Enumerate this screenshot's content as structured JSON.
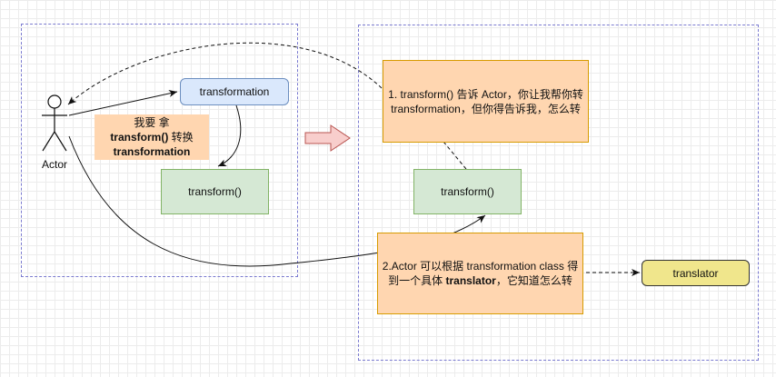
{
  "actor": {
    "label": "Actor"
  },
  "nodes": {
    "transformation_box": "transformation",
    "transform_left": "transform()",
    "transform_right": "transform()",
    "translator_box": "translator"
  },
  "note": {
    "line1": "我要 拿",
    "line2a": "transform()",
    "line2b": " 转换",
    "line3": "transformation"
  },
  "callout1": {
    "line1": "1. transform() 告诉 Actor，你让我帮你转",
    "line2": "transformation，但你得告诉我，怎么转"
  },
  "callout2": {
    "line1": "2.Actor 可以根据 transformation class 得",
    "line2a": "到一个具体 ",
    "line2b": "translator",
    "line2c": "，它知道怎么转"
  },
  "colors": {
    "frame": "#7b7bd0",
    "blue_fill": "#dae8fc",
    "green_fill": "#d5e8d4",
    "orange_fill": "#ffd6b0",
    "yellow_fill": "#f0e68c",
    "arrow_fill": "#f8cecc"
  }
}
